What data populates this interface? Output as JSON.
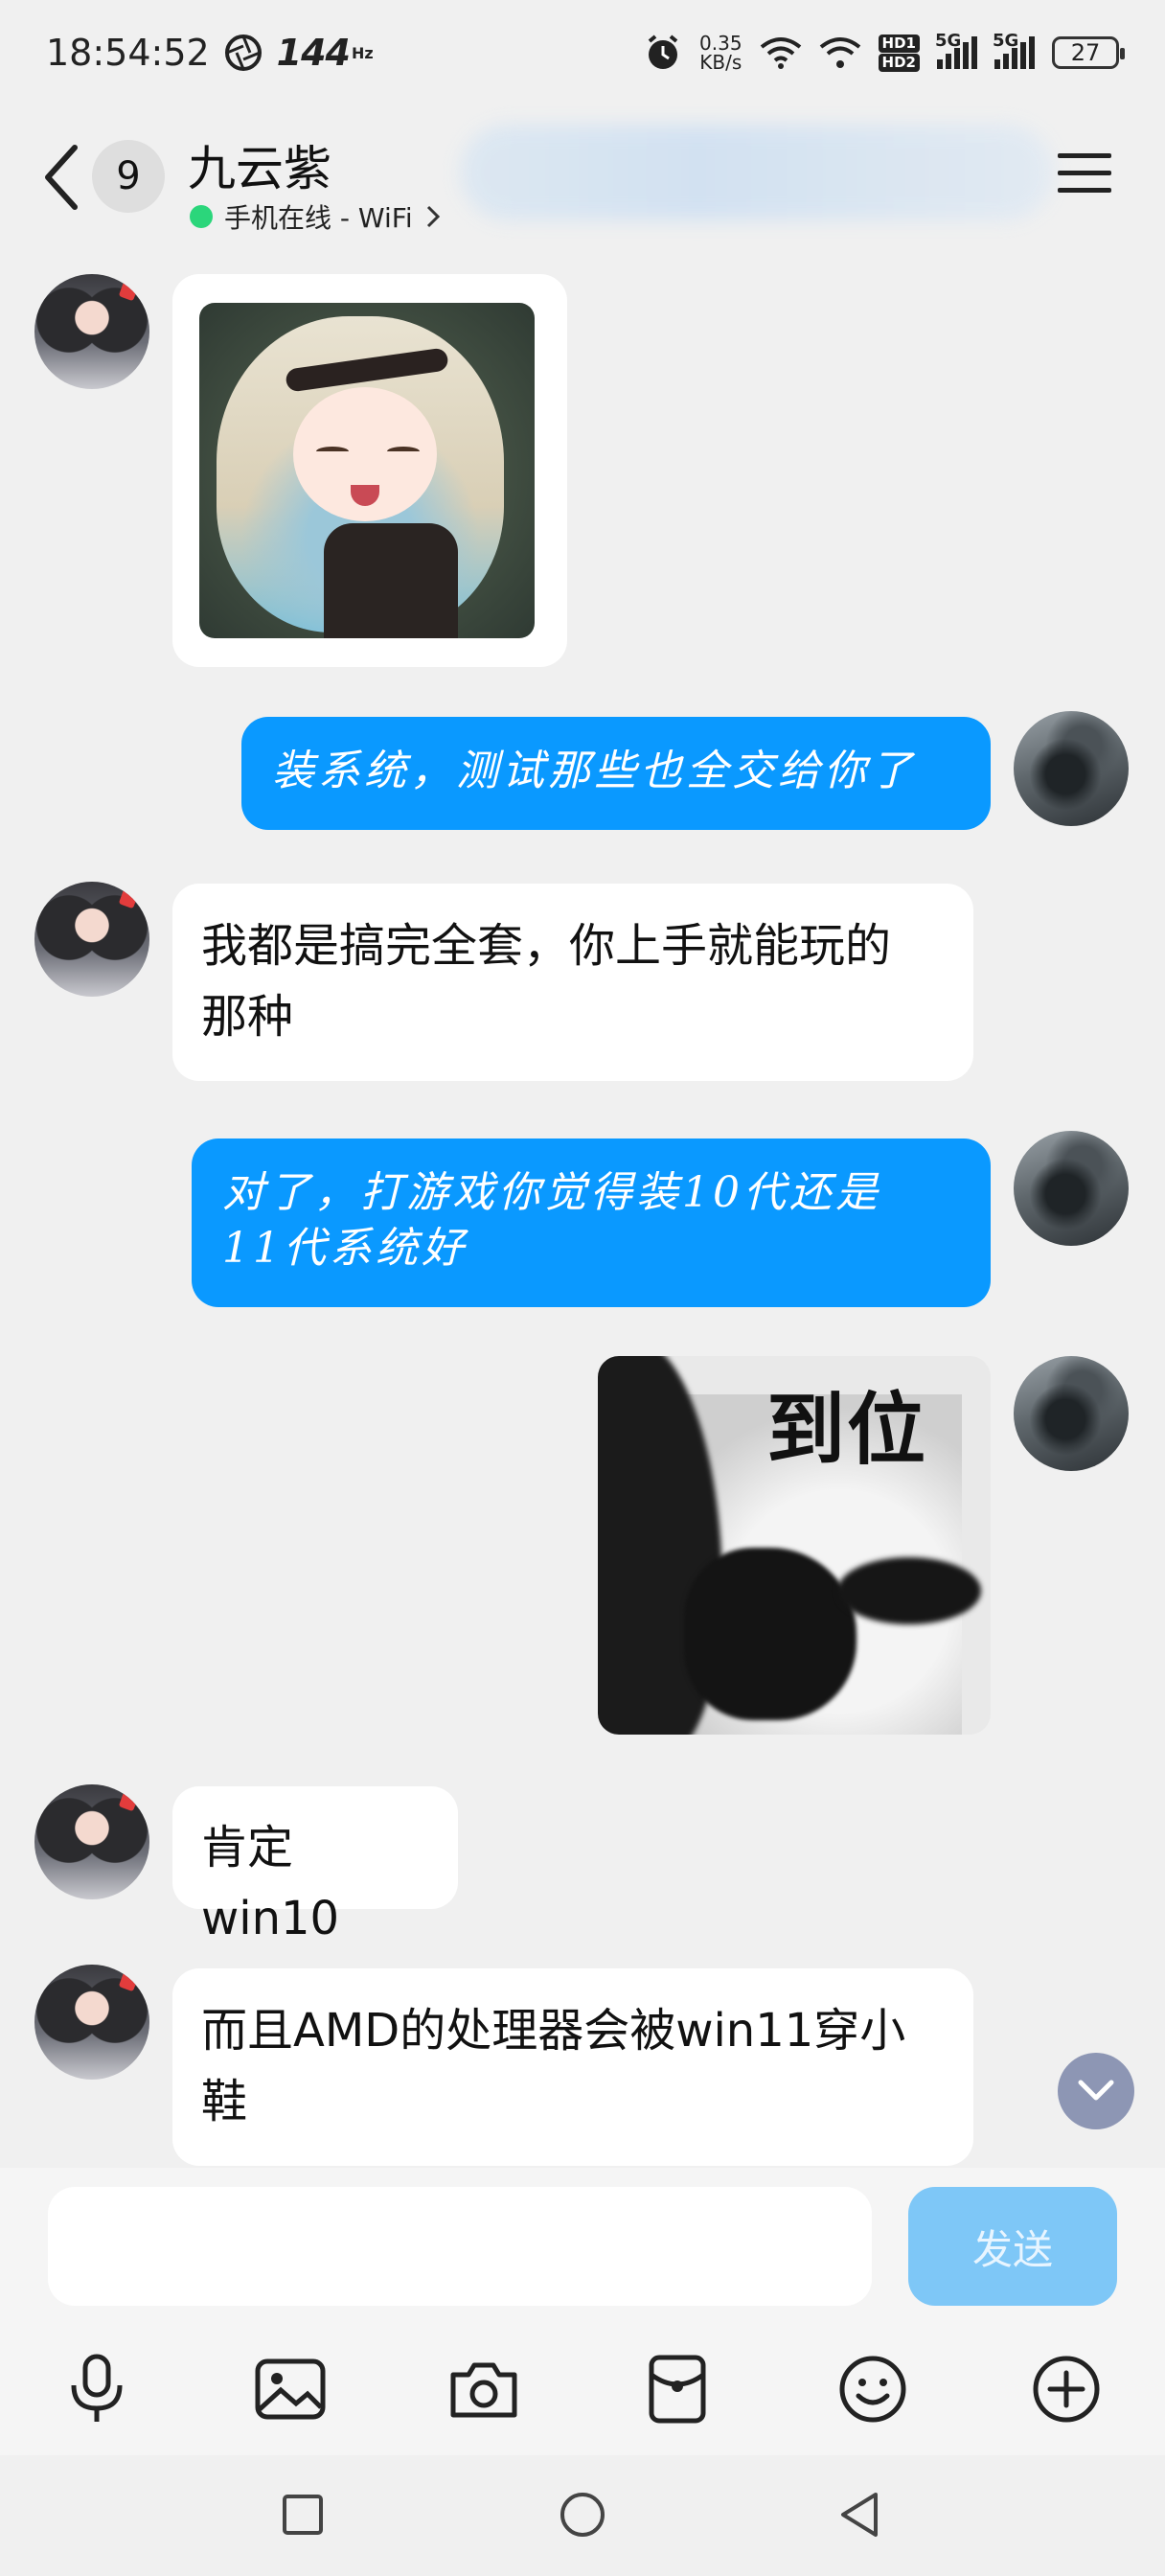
{
  "status_bar": {
    "time": "18:54:52",
    "refresh_rate": "144",
    "refresh_unit": "Hz",
    "net_speed_value": "0.35",
    "net_speed_unit": "KB/s",
    "hd_badge_1": "HD1",
    "hd_badge_2": "HD2",
    "signal_1": "5G",
    "signal_2": "5G",
    "battery": "27"
  },
  "header": {
    "unread_count": "9",
    "contact_name": "九云紫",
    "online_status": "手机在线 - WiFi"
  },
  "messages": [
    {
      "side": "in",
      "type": "sticker",
      "sticker": "anime-girl-sticker"
    },
    {
      "side": "out",
      "type": "text",
      "text": "装系统，测试那些也全交给你了"
    },
    {
      "side": "in",
      "type": "text",
      "line1": "我都是搞完全套，你上手就能玩的",
      "line2": "那种"
    },
    {
      "side": "out",
      "type": "text",
      "line1": "对了，打游戏你觉得装10代还是",
      "line2": "11代系统好"
    },
    {
      "side": "out",
      "type": "sticker",
      "sticker_text": "到位"
    },
    {
      "side": "in",
      "type": "text",
      "text": "肯定win10"
    },
    {
      "side": "in",
      "type": "text",
      "line1": "而且AMD的处理器会被win11穿小",
      "line2": "鞋"
    }
  ],
  "input": {
    "value": "",
    "send_label": "发送"
  },
  "toolbar": {
    "icons": [
      "microphone-icon",
      "image-icon",
      "camera-icon",
      "red-packet-icon",
      "emoji-icon",
      "plus-icon"
    ]
  },
  "colors": {
    "outgoing_bubble": "#0a99ff",
    "incoming_bubble": "#ffffff",
    "background": "#f0f0f0",
    "send_button": "#7ec7f7",
    "online_dot": "#2bd67b"
  }
}
